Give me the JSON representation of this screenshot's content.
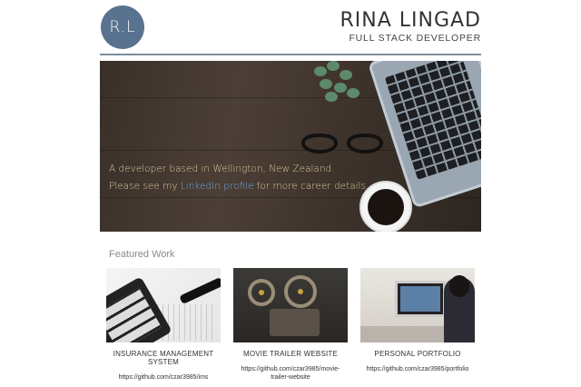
{
  "header": {
    "logo_text": "R.L",
    "name": "RINA LINGAD",
    "role": "FULL STACK DEVELOPER"
  },
  "hero": {
    "line1": "A developer based in Wellington, New Zealand.",
    "line2_before": "Please see my ",
    "line2_link": "LinkedIn profile",
    "line2_after": " for more career details."
  },
  "featured": {
    "title": "Featured Work",
    "items": [
      {
        "title": "INSURANCE MANAGEMENT SYSTEM",
        "link": "https://github.com/czar3985/ims"
      },
      {
        "title": "MOVIE TRAILER WEBSITE",
        "link": "https://github.com/czar3985/movie-trailer-website"
      },
      {
        "title": "PERSONAL PORTFOLIO",
        "link": "https://github.com/czar3985/portfolio"
      }
    ]
  },
  "colors": {
    "accent": "#58728f",
    "link": "#6fa8dc",
    "hero_text": "#d8c79c"
  }
}
